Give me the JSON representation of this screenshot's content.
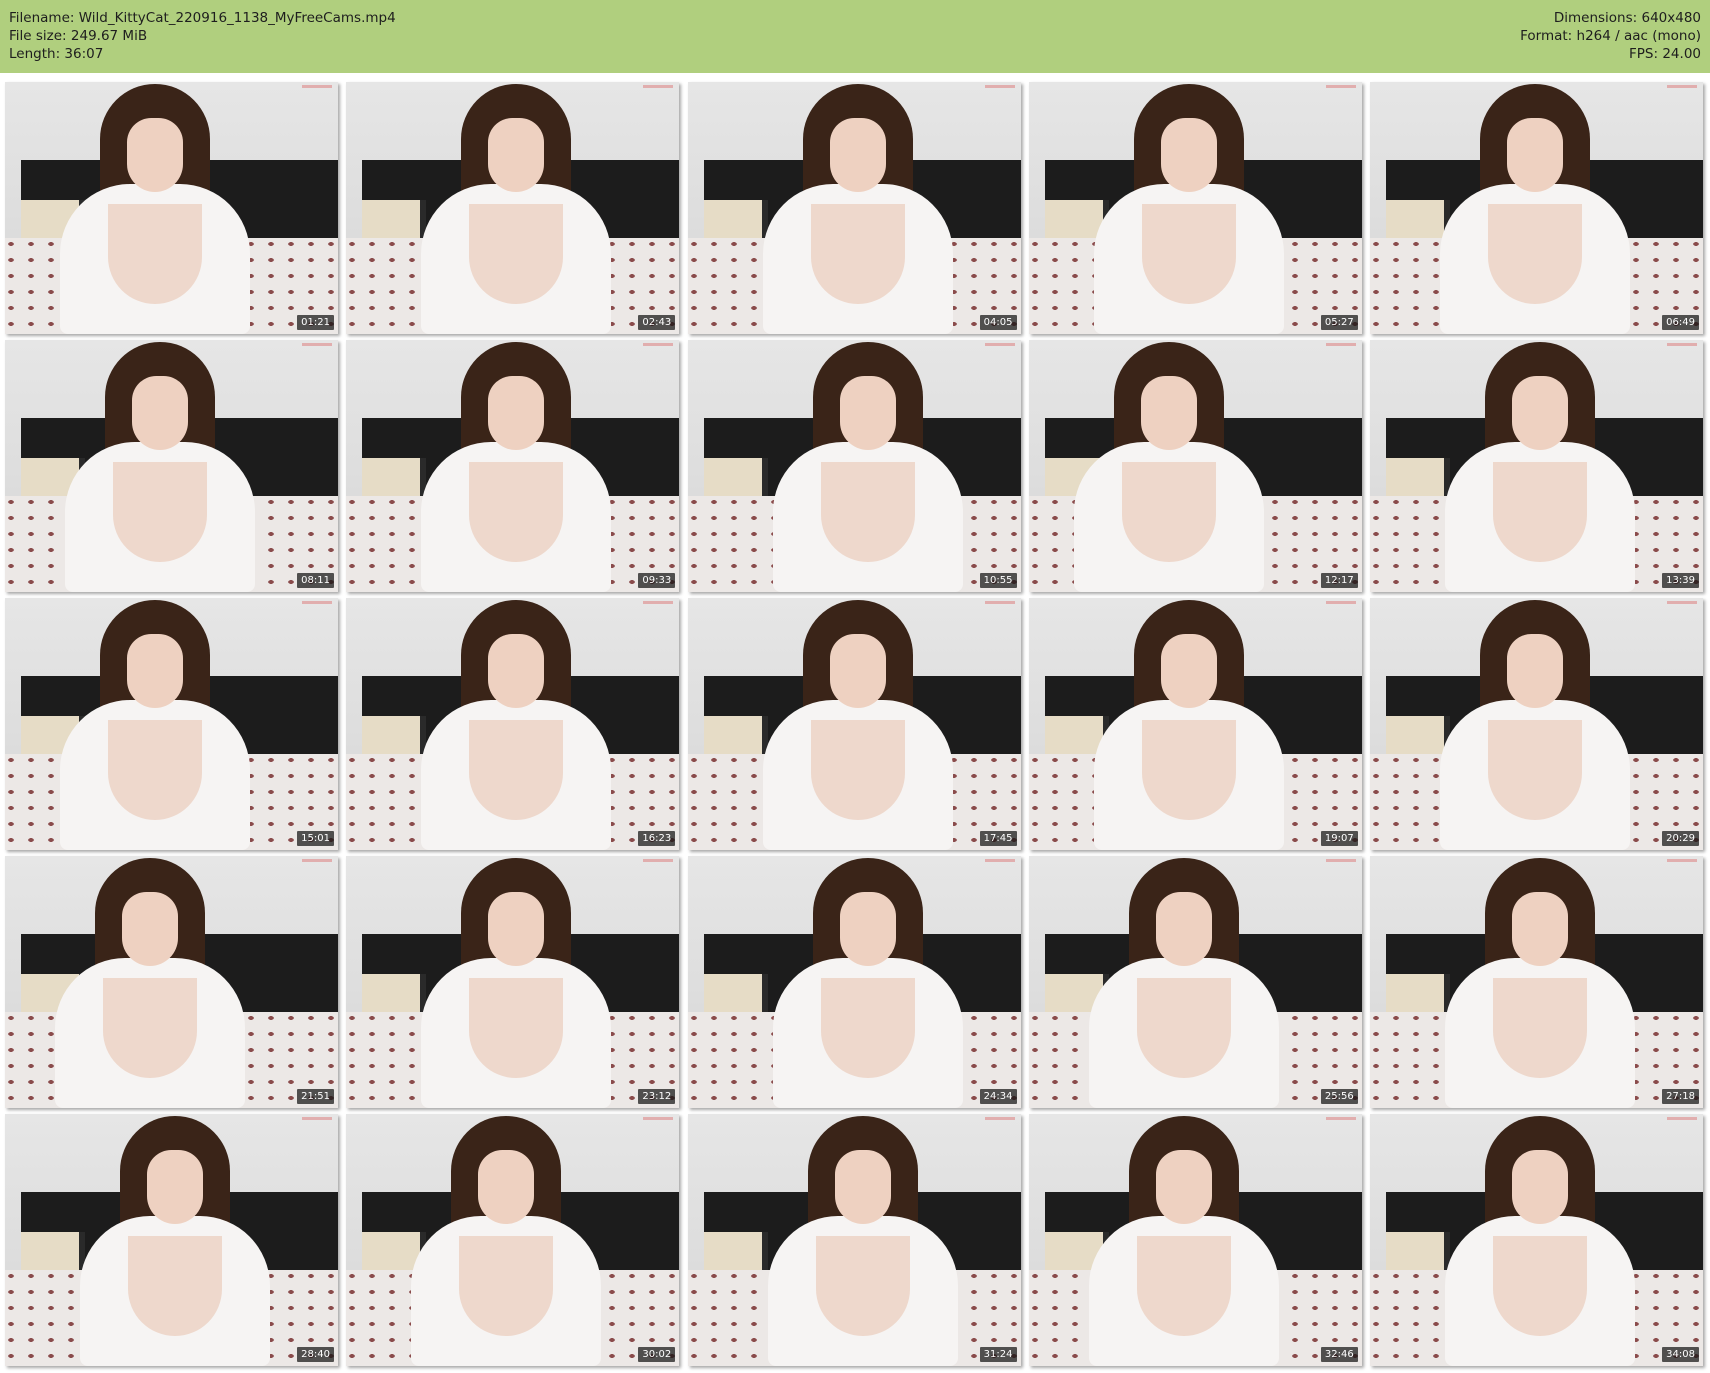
{
  "header": {
    "filename": "Filename: Wild_KittyCat_220916_1138_MyFreeCams.mp4",
    "file_size": "File size: 249.67 MiB",
    "length": "Length: 36:07",
    "dimensions": "Dimensions: 640x480",
    "format": "Format: h264 / aac (mono)",
    "fps": "FPS: 24.00",
    "background_color": "#b0cf7e"
  },
  "thumbnails": [
    "01:21",
    "02:43",
    "04:05",
    "05:27",
    "06:49",
    "08:11",
    "09:33",
    "10:55",
    "12:17",
    "13:39",
    "15:01",
    "16:23",
    "17:45",
    "19:07",
    "20:29",
    "21:51",
    "23:12",
    "24:34",
    "25:56",
    "27:18",
    "28:40",
    "30:02",
    "31:24",
    "32:46",
    "34:08"
  ]
}
